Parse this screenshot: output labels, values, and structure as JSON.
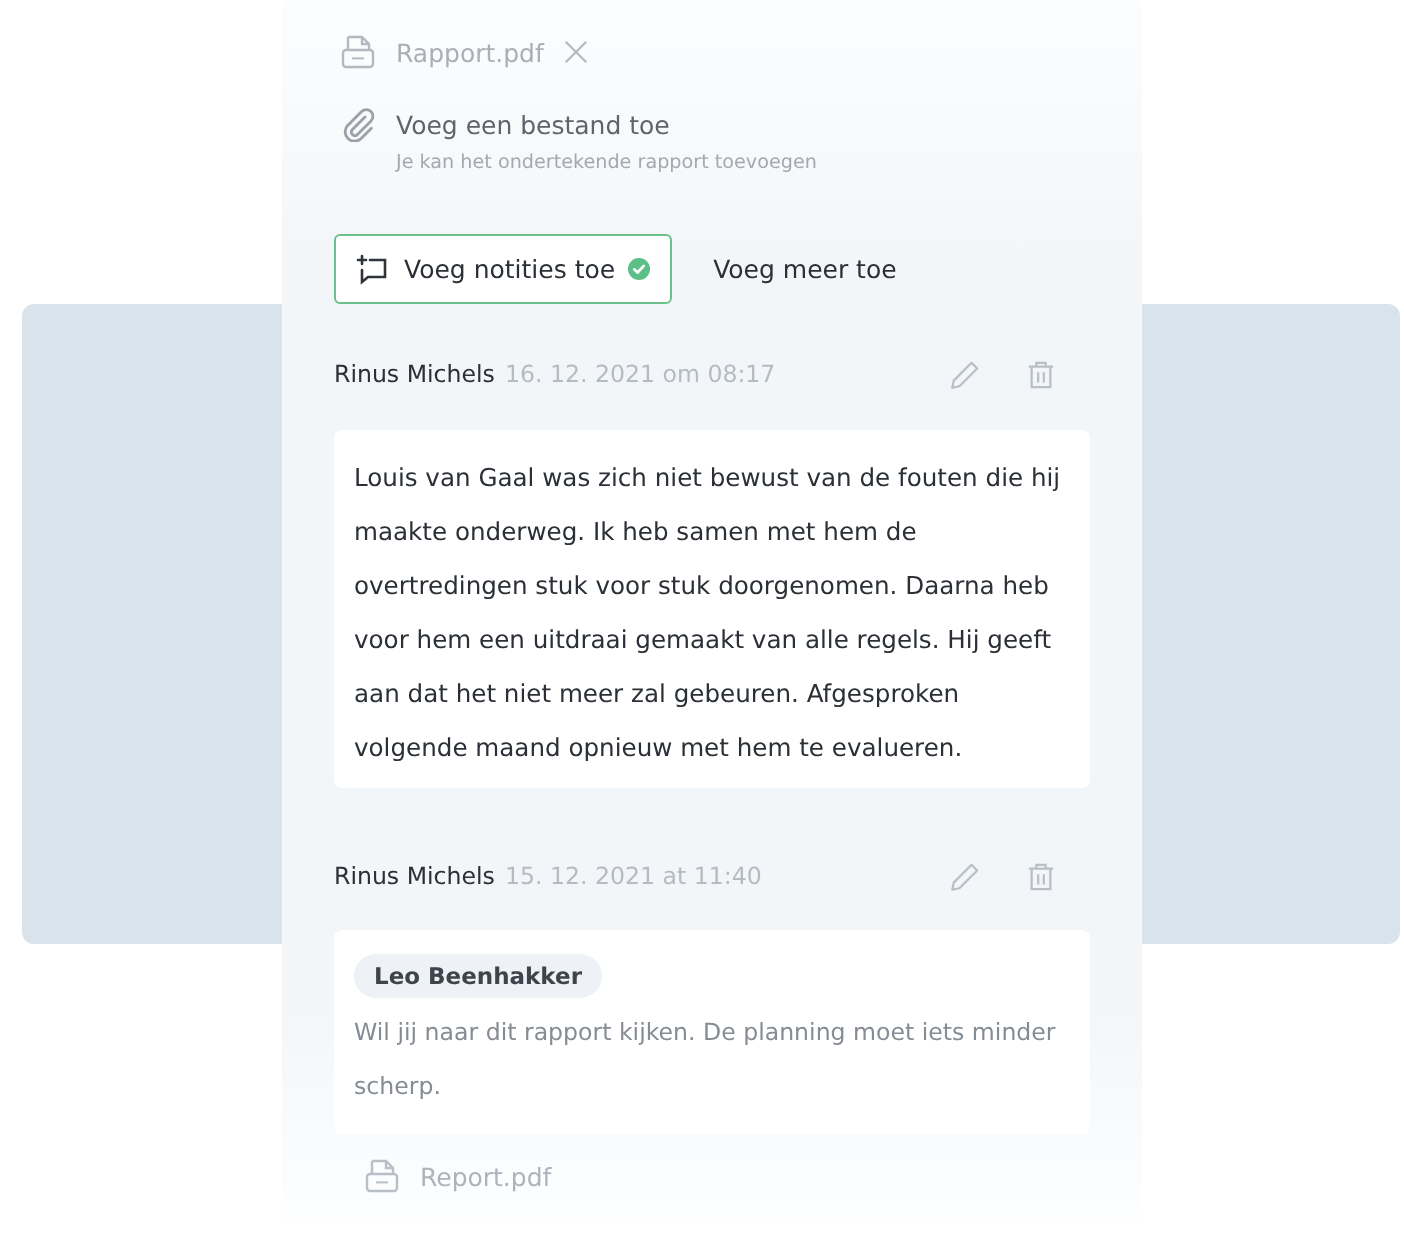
{
  "attachment": {
    "file_name": "Rapport.pdf"
  },
  "add_file": {
    "label": "Voeg een bestand toe",
    "hint": "Je kan het ondertekende rapport toevoegen"
  },
  "tabs": [
    {
      "label": "Voeg notities toe",
      "selected": true,
      "done": true
    },
    {
      "label": "Voeg meer toe",
      "selected": false,
      "done": false
    }
  ],
  "notes": [
    {
      "author": "Rinus Michels",
      "timestamp": "16. 12. 2021 om 08:17",
      "body": "Louis van Gaal was zich niet bewust van de fouten die hij maakte onderweg. Ik heb samen met hem de overtredingen stuk voor stuk doorgenomen. Daarna heb voor hem een uitdraai gemaakt van alle regels. Hij geeft aan dat het niet meer zal gebeuren. Afgesproken volgende maand opnieuw met hem te evalueren."
    },
    {
      "author": "Rinus Michels",
      "timestamp": "15. 12. 2021 at 11:40",
      "mention": "Leo Beenhakker",
      "body": "Wil jij naar dit rapport kijken. De planning moet iets minder scherp.",
      "attachment": "Report.pdf"
    }
  ]
}
